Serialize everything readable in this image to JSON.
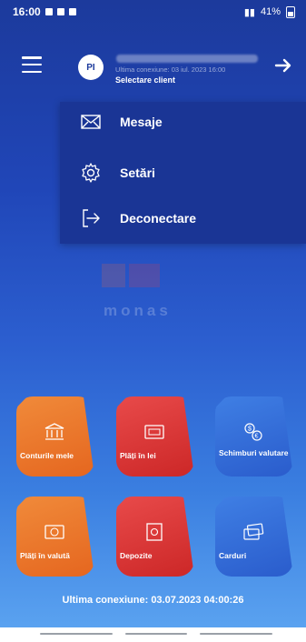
{
  "status_bar": {
    "time": "16:00",
    "battery": "41%"
  },
  "header": {
    "avatar_initials": "PI",
    "last_connection_top": "Ultima conexiune: 03 iul. 2023 16:00",
    "select_client_label": "Selectare client"
  },
  "menu": {
    "items": [
      {
        "label": "Mesaje",
        "icon": "envelope-icon"
      },
      {
        "label": "Setări",
        "icon": "gear-icon"
      },
      {
        "label": "Deconectare",
        "icon": "logout-icon"
      }
    ]
  },
  "logo": {
    "text": "monas"
  },
  "tiles": [
    {
      "label": "Conturile mele",
      "icon": "bank-icon",
      "color": "#e5661f"
    },
    {
      "label": "Plăți în lei",
      "icon": "payment-lei-icon",
      "color": "#cc2727"
    },
    {
      "label": "Schimburi valutare",
      "icon": "currency-exchange-icon",
      "color": "#2a5ccc"
    },
    {
      "label": "Plăți în valută",
      "icon": "foreign-payment-icon",
      "color": "#e5661f"
    },
    {
      "label": "Depozite",
      "icon": "safe-icon",
      "color": "#cc2727"
    },
    {
      "label": "Carduri",
      "icon": "cards-icon",
      "color": "#2a5ccc"
    }
  ],
  "footer": {
    "last_connection": "Ultima conexiune: 03.07.2023 04:00:26"
  }
}
